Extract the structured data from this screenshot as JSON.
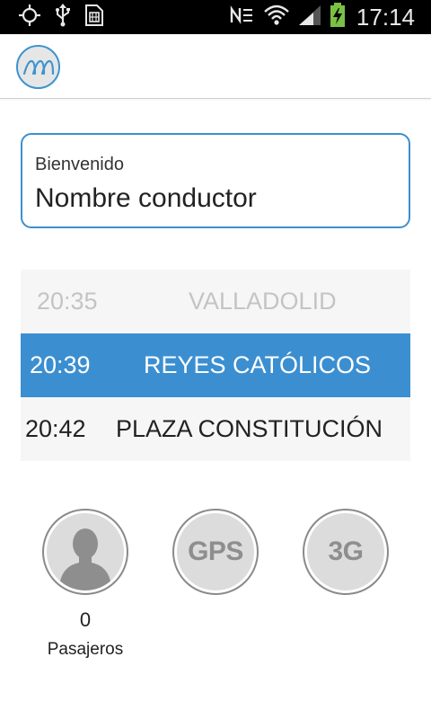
{
  "status_bar": {
    "time": "17:14",
    "icons": [
      "gps-icon",
      "usb-icon",
      "sim-icon",
      "nfc-icon",
      "wifi-icon",
      "signal-icon",
      "battery-charging-icon"
    ]
  },
  "app_bar": {
    "logo_icon": "app-logo-icon"
  },
  "welcome": {
    "label": "Bienvenido",
    "driver_name": "Nombre conductor"
  },
  "stops": [
    {
      "time": "20:35",
      "name": "VALLADOLID",
      "state": "previous"
    },
    {
      "time": "20:39",
      "name": "REYES CATÓLICOS",
      "state": "current"
    },
    {
      "time": "20:42",
      "name": "PLAZA CONSTITUCIÓN",
      "state": "next"
    }
  ],
  "indicators": {
    "passengers": {
      "icon": "person-icon",
      "count": "0",
      "label": "Pasajeros"
    },
    "gps": {
      "label": "GPS"
    },
    "network": {
      "label": "3G"
    }
  },
  "colors": {
    "accent": "#3b8fd1",
    "status_bar": "#000000",
    "indicator_inactive": "#dcdcdc"
  }
}
